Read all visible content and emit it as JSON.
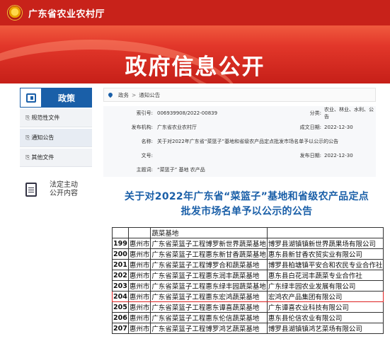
{
  "site": {
    "title": "广东省农业农村厅",
    "emblem_icon": "national-emblem-icon"
  },
  "banner": {
    "title": "政府信息公开"
  },
  "sidebar": {
    "header_label": "政策",
    "items": [
      {
        "label": "规范性文件"
      },
      {
        "label": "通知公告"
      },
      {
        "label": "其他文件"
      }
    ],
    "disclosure": {
      "line1": "法定主动",
      "line2": "公开内容"
    }
  },
  "breadcrumb": {
    "home": "政务",
    "current": "通知公告",
    "separator": ">"
  },
  "meta": {
    "index_label": "索引号:",
    "index_value": "006939908/2022-00839",
    "category_label": "分类:",
    "category_value": "农业、林业、水利、公告",
    "publisher_label": "发布机构:",
    "publisher_value": "广东省农业农村厅",
    "created_label": "成文日期:",
    "created_value": "2022-12-30",
    "name_label": "名称:",
    "name_value": "关于对2022年广东省“菜篮子”基地和省级农产品定点批发市场名单予以公示的公告",
    "docno_label": "文号:",
    "docno_value": "",
    "pubdate_label": "发布日期:",
    "pubdate_value": "2022-12-30",
    "keywords_label": "主题词:",
    "keywords_value": "“菜篮子” 基地 农产品"
  },
  "article": {
    "title_line1": "关于对2022年广东省“菜篮子”基地和省级农产品定点",
    "title_line2": "批发市场名单予以公示的公告"
  },
  "table": {
    "header": {
      "num": "",
      "city": "",
      "name": "蔬菜基地",
      "org": ""
    },
    "rows": [
      {
        "num": "199",
        "city": "惠州市",
        "name": "广东省菜篮子工程博罗新世界蔬菜基地",
        "org": "博罗县湖镇镇新世界蔬果场有限公司"
      },
      {
        "num": "200",
        "city": "惠州市",
        "name": "广东省菜篮子工程惠东新甘香蔬菜基地",
        "org": "惠东县新甘香农贸实业有限公司"
      },
      {
        "num": "201",
        "city": "惠州市",
        "name": "广东省菜篮子工程博罗合和蔬菜基地",
        "org": "博罗县柏塘镇平安合和农民专业合作社"
      },
      {
        "num": "202",
        "city": "惠州市",
        "name": "广东省菜篮子工程惠东润丰蔬菜基地",
        "org": "惠东县白花润丰蔬菜专业合作社"
      },
      {
        "num": "203",
        "city": "惠州市",
        "name": "广东省菜篮子工程惠东绿丰园蔬菜基地",
        "org": "广东绿丰园农业发展有限公司"
      },
      {
        "num": "204",
        "city": "惠州市",
        "name": "广东省菜篮子工程惠东宏鸿蔬菜基地",
        "org": "宏鸿农产品集团有限公司",
        "highlight": true
      },
      {
        "num": "205",
        "city": "惠州市",
        "name": "广东省菜篮子工程惠东谭喜蔬菜基地",
        "org": "广东谭喜农业科技有限公司"
      },
      {
        "num": "206",
        "city": "惠州市",
        "name": "广东省菜篮子工程惠东伦信蔬菜基地",
        "org": "惠东县伦信农业有限公司"
      },
      {
        "num": "207",
        "city": "惠州市",
        "name": "广东省菜篮子工程博罗鸿艺蔬菜基地",
        "org": "博罗县湖镇镇鸿艺菜场有限公司"
      }
    ]
  },
  "colors": {
    "brand_red": "#c8221a",
    "link_blue": "#1a5fa8",
    "highlight_red": "#dd2222"
  }
}
